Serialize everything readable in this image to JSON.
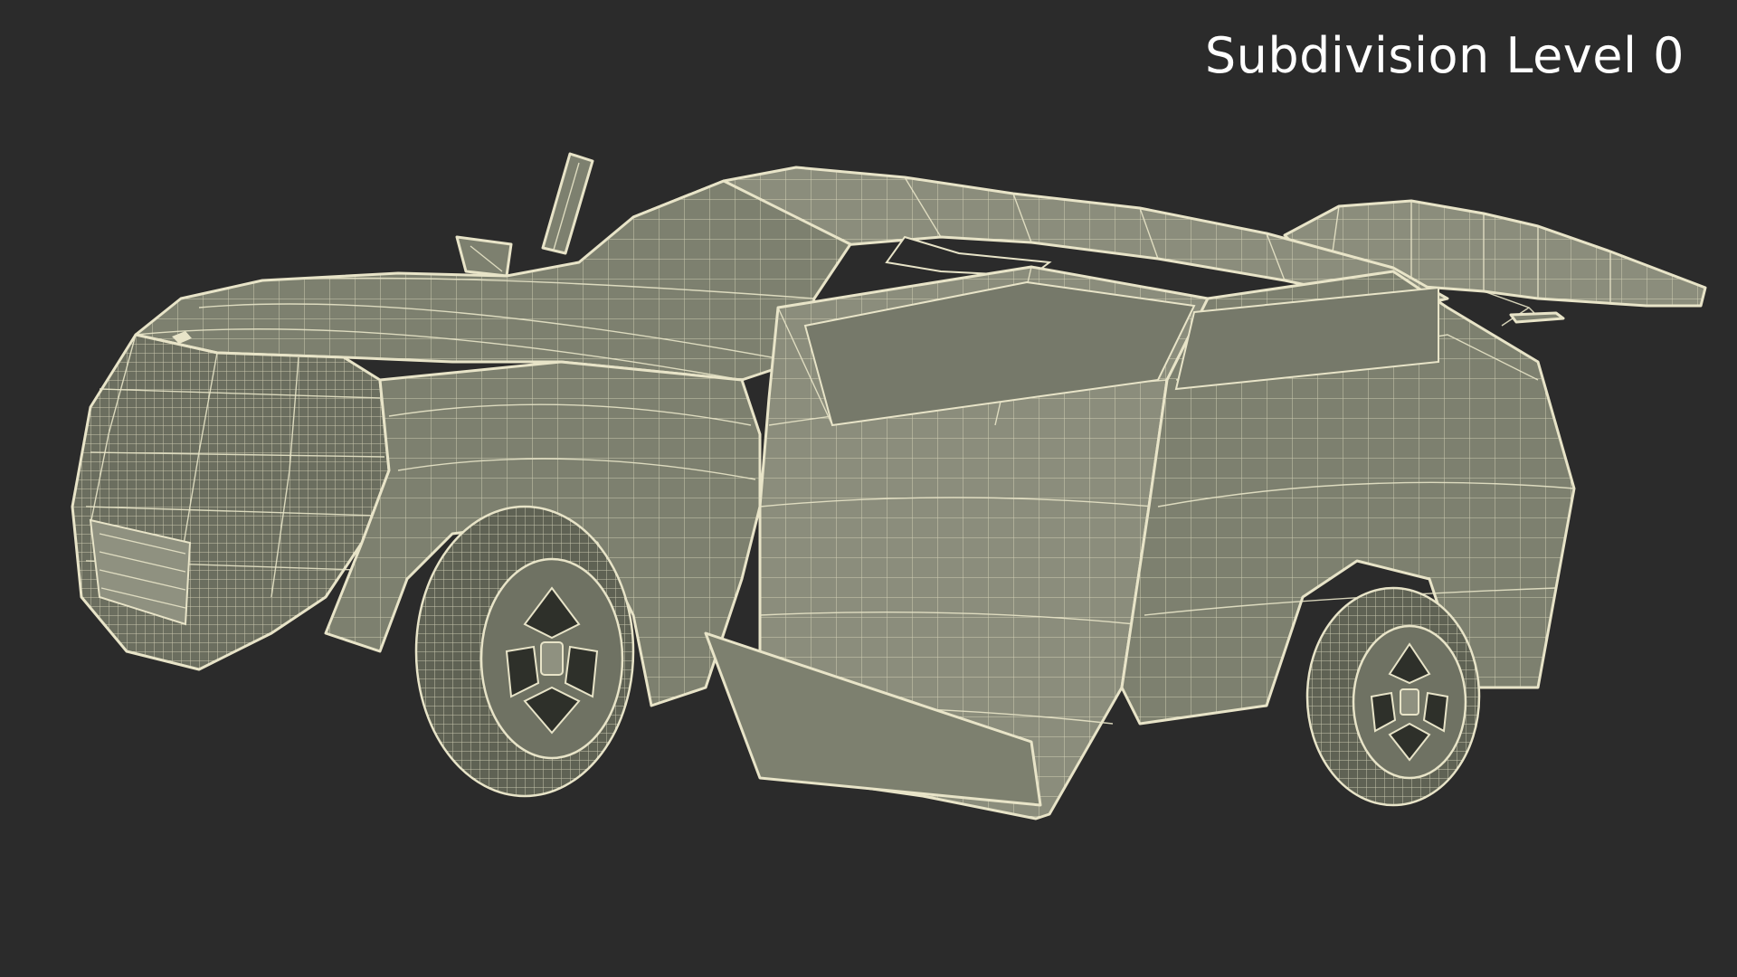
{
  "viewport": {
    "label": "Subdivision Level 0",
    "background": "#2b2b2b",
    "wire_color": "#e8e4c8",
    "surface_color": "#7d806f"
  }
}
